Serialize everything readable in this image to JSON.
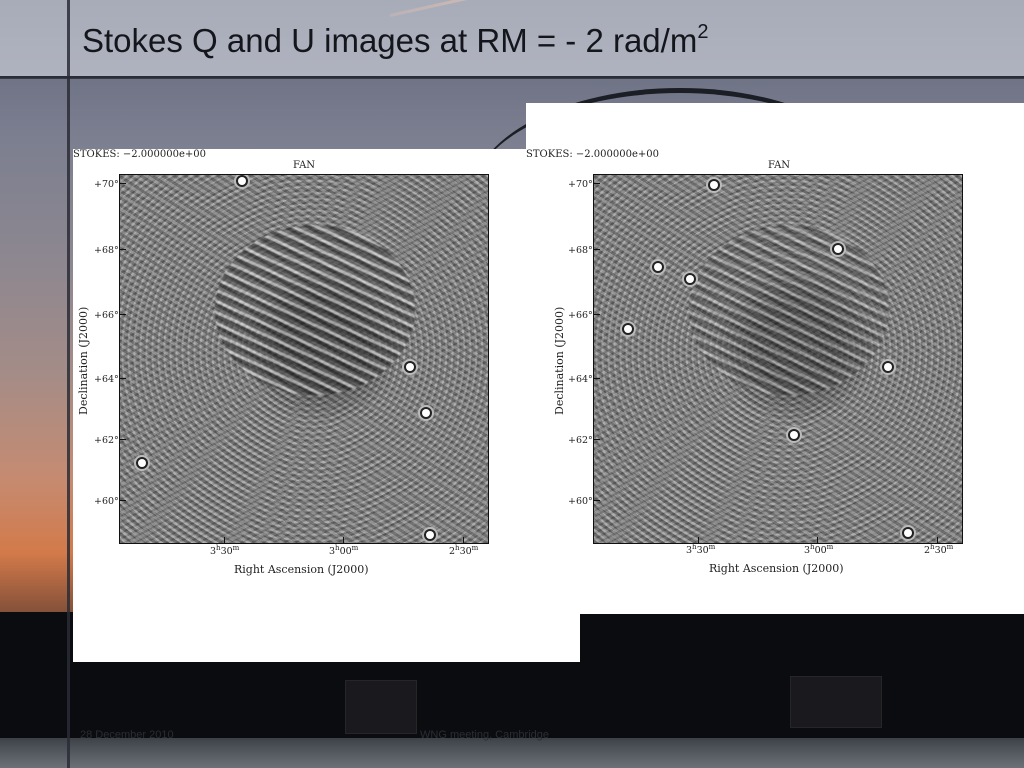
{
  "slide": {
    "title": {
      "text": "Stokes Q and U images at RM = - 2 rad/m",
      "superscript": "2"
    },
    "footer": {
      "left": "28 December 2010",
      "center": "WNG meeting, Cambridge"
    }
  },
  "figures": [
    {
      "stokes_label": "STOKES:  −2.000000e+00",
      "plot_title": "FAN",
      "y_ticks": [
        "+70°",
        "+68°",
        "+66°",
        "+64°",
        "+62°",
        "+60°"
      ],
      "x_ticks": [
        {
          "h": "3",
          "m": "30"
        },
        {
          "h": "3",
          "m": "00"
        },
        {
          "h": "2",
          "m": "30"
        }
      ],
      "xlabel": "Right Ascension (J2000)",
      "ylabel": "Declination (J2000)"
    },
    {
      "stokes_label": "STOKES:  −2.000000e+00",
      "plot_title": "FAN",
      "y_ticks": [
        "+70°",
        "+68°",
        "+66°",
        "+64°",
        "+62°",
        "+60°"
      ],
      "x_ticks": [
        {
          "h": "3",
          "m": "30"
        },
        {
          "h": "3",
          "m": "00"
        },
        {
          "h": "2",
          "m": "30"
        }
      ],
      "xlabel": "Right Ascension (J2000)",
      "ylabel": "Declination (J2000)"
    }
  ],
  "colors": {
    "title_text": "#14161c",
    "panel_bg": "#ffffff"
  }
}
